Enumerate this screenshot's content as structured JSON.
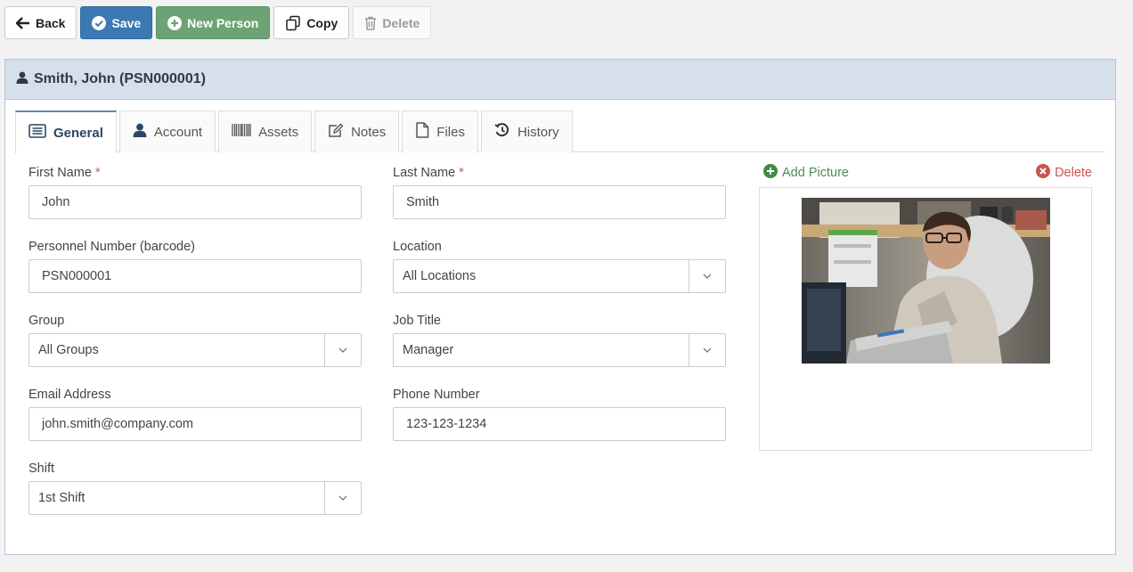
{
  "toolbar": {
    "back": "Back",
    "save": "Save",
    "new_person": "New Person",
    "copy": "Copy",
    "delete": "Delete"
  },
  "panel": {
    "title": "Smith, John (PSN000001)"
  },
  "tabs": [
    {
      "label": "General",
      "icon": "list-icon",
      "active": true
    },
    {
      "label": "Account",
      "icon": "user-icon"
    },
    {
      "label": "Assets",
      "icon": "barcode-icon"
    },
    {
      "label": "Notes",
      "icon": "edit-icon"
    },
    {
      "label": "Files",
      "icon": "file-icon"
    },
    {
      "label": "History",
      "icon": "history-icon"
    }
  ],
  "form": {
    "first_name": {
      "label": "First Name",
      "required": "*",
      "value": "John"
    },
    "last_name": {
      "label": "Last Name",
      "required": "*",
      "value": "Smith"
    },
    "personnel_number": {
      "label": "Personnel Number (barcode)",
      "value": "PSN000001"
    },
    "location": {
      "label": "Location",
      "value": "All Locations"
    },
    "group": {
      "label": "Group",
      "value": "All Groups"
    },
    "job_title": {
      "label": "Job Title",
      "value": "Manager"
    },
    "email": {
      "label": "Email Address",
      "value": "john.smith@company.com"
    },
    "phone": {
      "label": "Phone Number",
      "value": "123-123-1234"
    },
    "shift": {
      "label": "Shift",
      "value": "1st Shift"
    }
  },
  "picture": {
    "add_label": "Add Picture",
    "delete_label": "Delete"
  },
  "colors": {
    "primary": "#3c78b4",
    "success": "#6da374",
    "danger": "#c9554f",
    "header_bg": "#d7dfea"
  }
}
